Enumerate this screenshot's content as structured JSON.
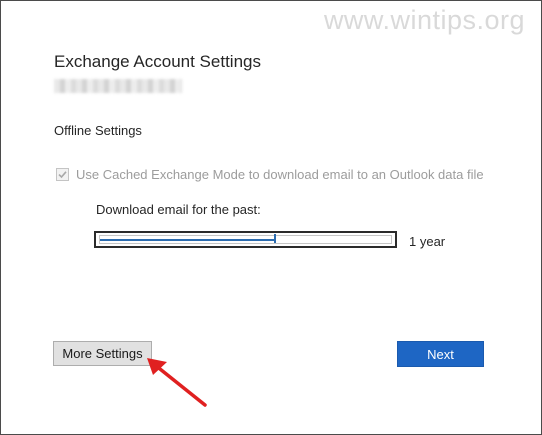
{
  "watermark": "www.wintips.org",
  "dialog": {
    "title": "Exchange Account Settings",
    "section_label": "Offline Settings",
    "cached_mode": {
      "label": "Use Cached Exchange Mode to download email to an Outlook data file",
      "checked": true,
      "disabled": true
    },
    "download": {
      "label": "Download email for the past:",
      "value_label": "1 year",
      "slider_fraction": 0.6
    },
    "buttons": {
      "more_settings": "More Settings",
      "next": "Next"
    }
  },
  "colors": {
    "accent": "#1e66c4",
    "annotation_arrow": "#e02020",
    "slider": "#2b6cb0"
  },
  "icons": {
    "checkbox": "check-icon",
    "annotation": "red-arrow-icon"
  }
}
